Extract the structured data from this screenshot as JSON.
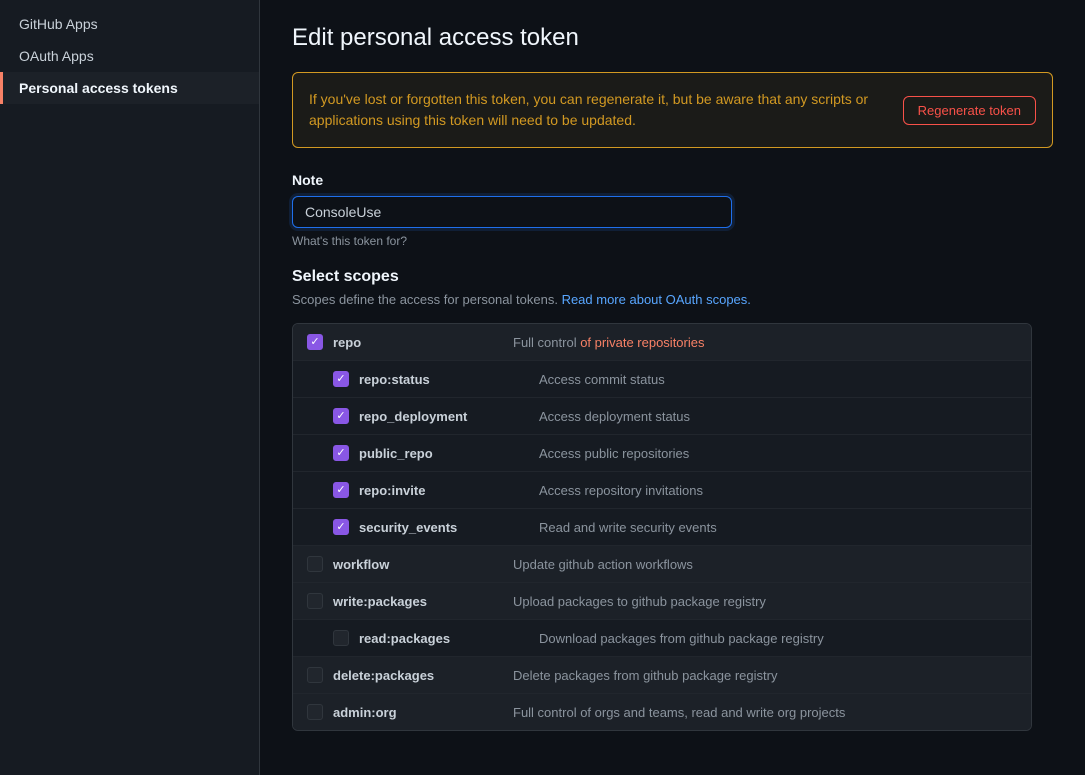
{
  "sidebar": {
    "items": [
      {
        "id": "github-apps",
        "label": "GitHub Apps",
        "active": false
      },
      {
        "id": "oauth-apps",
        "label": "OAuth Apps",
        "active": false
      },
      {
        "id": "personal-access-tokens",
        "label": "Personal access tokens",
        "active": true
      }
    ]
  },
  "page": {
    "title": "Edit personal access token"
  },
  "warning": {
    "text": "If you've lost or forgotten this token, you can regenerate it, but be aware that any scripts or applications using this token will need to be updated.",
    "regenerate_label": "Regenerate token"
  },
  "form": {
    "note_label": "Note",
    "note_value": "ConsoleUse",
    "note_placeholder": "What's this token for?",
    "note_hint": "What's this token for?",
    "scopes_title": "Select scopes",
    "scopes_desc_prefix": "Scopes define the access for personal tokens.",
    "scopes_link_text": "Read more about OAuth scopes.",
    "scopes_link_url": "#"
  },
  "scopes": [
    {
      "id": "repo",
      "name": "repo",
      "desc_prefix": "Full control ",
      "desc_highlight": "of private repositories",
      "checked": true,
      "parent": true,
      "children": [
        {
          "id": "repo-status",
          "name": "repo:status",
          "desc": "Access commit status",
          "checked": true
        },
        {
          "id": "repo-deployment",
          "name": "repo_deployment",
          "desc": "Access deployment status",
          "checked": true
        },
        {
          "id": "public-repo",
          "name": "public_repo",
          "desc": "Access public repositories",
          "checked": true
        },
        {
          "id": "repo-invite",
          "name": "repo:invite",
          "desc": "Access repository invitations",
          "checked": true
        },
        {
          "id": "security-events",
          "name": "security_events",
          "desc": "Read and write security events",
          "checked": true
        }
      ]
    },
    {
      "id": "workflow",
      "name": "workflow",
      "desc": "Update github action workflows",
      "checked": false,
      "parent": true,
      "children": []
    },
    {
      "id": "write-packages",
      "name": "write:packages",
      "desc": "Upload packages to github package registry",
      "checked": false,
      "parent": true,
      "children": [
        {
          "id": "read-packages",
          "name": "read:packages",
          "desc": "Download packages from github package registry",
          "checked": false
        }
      ]
    },
    {
      "id": "delete-packages",
      "name": "delete:packages",
      "desc": "Delete packages from github package registry",
      "checked": false,
      "parent": true,
      "children": []
    },
    {
      "id": "admin-org",
      "name": "admin:org",
      "desc": "Full control of orgs and teams, read and write org projects",
      "checked": false,
      "parent": true,
      "children": []
    }
  ]
}
